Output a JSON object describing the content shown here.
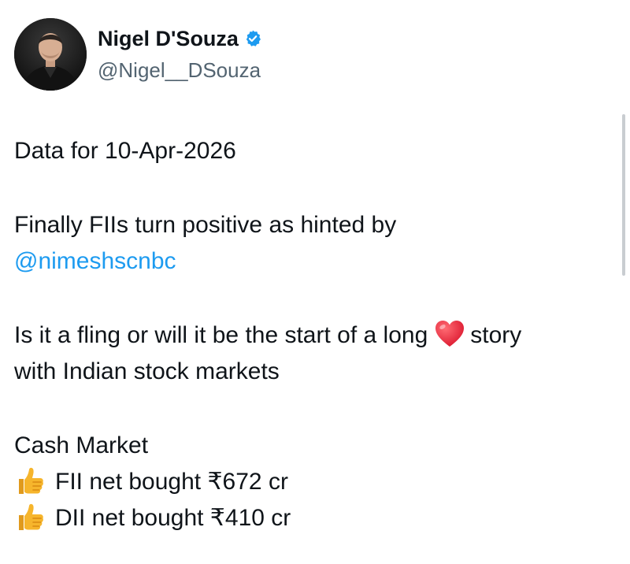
{
  "author": {
    "display_name": "Nigel D'Souza",
    "handle": "@Nigel__DSouza",
    "verified": true,
    "avatar_icon": "profile-photo-avatar",
    "verified_icon": "verified-badge-icon",
    "verified_color": "#1d9bf0"
  },
  "tweet": {
    "date_line": "Data for 10-Apr-2026",
    "para2_line1": "Finally FIIs turn positive as hinted by",
    "mention": "@nimeshscnbc",
    "para3_line1_before": "Is it a fling or will it be the start of a long",
    "para3_line1_after": "story",
    "para3_line2": "with Indian stock markets",
    "section_title": "Cash Market",
    "items": [
      {
        "icon": "thumbs-up-icon",
        "text": "FII net bought ₹672 cr"
      },
      {
        "icon": "thumbs-up-icon",
        "text": "DII net bought ₹410 cr"
      }
    ],
    "heart_icon": "red-heart-icon"
  },
  "colors": {
    "text": "#0f1419",
    "secondary": "#536471",
    "link": "#1d9bf0",
    "heart": "#e0243f",
    "thumbs": "#f5b82e"
  }
}
